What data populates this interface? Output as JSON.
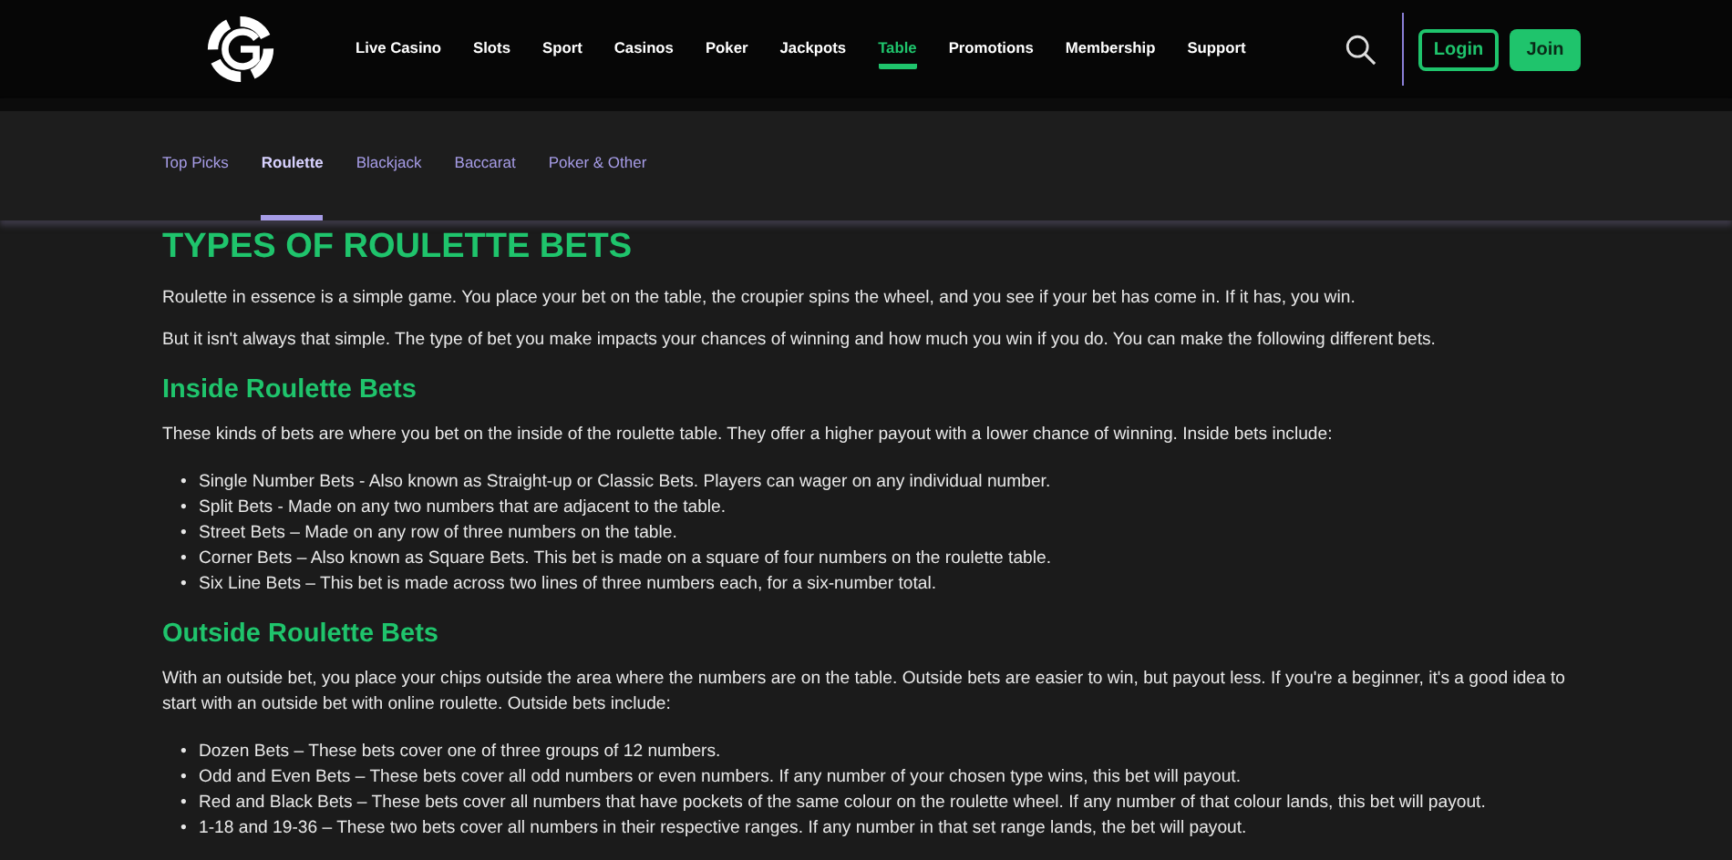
{
  "nav": {
    "links": [
      {
        "label": "Live Casino",
        "selected": false
      },
      {
        "label": "Slots",
        "selected": false
      },
      {
        "label": "Sport",
        "selected": false
      },
      {
        "label": "Casinos",
        "selected": false
      },
      {
        "label": "Poker",
        "selected": false
      },
      {
        "label": "Jackpots",
        "selected": false
      },
      {
        "label": "Table",
        "selected": true
      },
      {
        "label": "Promotions",
        "selected": false
      },
      {
        "label": "Membership",
        "selected": false
      },
      {
        "label": "Support",
        "selected": false
      }
    ],
    "login": "Login",
    "join": "Join"
  },
  "subnav": [
    {
      "label": "Top Picks",
      "selected": false
    },
    {
      "label": "Roulette",
      "selected": true
    },
    {
      "label": "Blackjack",
      "selected": false
    },
    {
      "label": "Baccarat",
      "selected": false
    },
    {
      "label": "Poker & Other",
      "selected": false
    }
  ],
  "content": [
    {
      "kind": "title",
      "text": "TYPES OF ROULETTE BETS"
    },
    {
      "kind": "paragraph",
      "text": "Roulette in essence is a simple game. You place your bet on the table, the croupier spins the wheel, and you see if your bet has come in. If it has, you win."
    },
    {
      "kind": "paragraph",
      "text": "But it isn't always that simple. The type of bet you make impacts your chances of winning and how much you win if you do. You can make the following different bets."
    },
    {
      "kind": "heading",
      "text": "Inside Roulette Bets"
    },
    {
      "kind": "paragraph",
      "text": "These kinds of bets are where you bet on the inside of the roulette table. They offer a higher payout with a lower chance of winning. Inside bets include:"
    },
    {
      "kind": "list",
      "marker": "•",
      "items": [
        "Single Number Bets - Also known as Straight-up or Classic Bets. Players can wager on any individual number.",
        "Split Bets - Made on any two numbers that are adjacent to the table.",
        "Street Bets – Made on any row of three numbers on the table.",
        "Corner Bets – Also known as Square Bets. This bet is made on a square of four numbers on the roulette table.",
        "Six Line Bets – This bet is made across two lines of three numbers each, for a six-number total."
      ]
    },
    {
      "kind": "heading",
      "text": "Outside Roulette Bets"
    },
    {
      "kind": "paragraph",
      "text": "With an outside bet, you place your chips outside the area where the numbers are on the table. Outside bets are easier to win, but payout less. If you're a beginner, it's a good idea to start with an outside bet with online roulette. Outside bets include:"
    },
    {
      "kind": "list",
      "marker": "•",
      "items": [
        "Dozen Bets – These bets cover one of three groups of 12 numbers.",
        "Odd and Even Bets – These bets cover all odd numbers or even numbers. If any number of your chosen type wins, this bet will payout.",
        "Red and Black Bets – These bets cover all numbers that have pockets of the same colour on the roulette wheel. If any number of that colour lands, this bet will payout.",
        "1-18 and 19-36 – These two bets cover all numbers in their respective ranges. If any number in that set range lands, the bet will payout."
      ]
    }
  ]
}
